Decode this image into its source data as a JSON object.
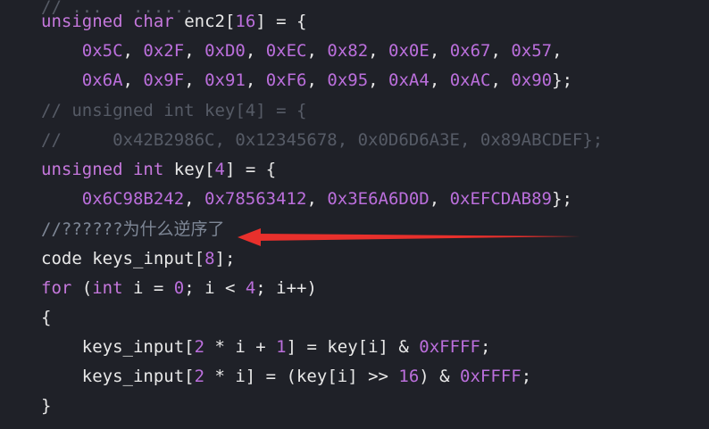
{
  "code_lines": [
    {
      "tokens": [
        {
          "t": "cm-faint",
          "v": "// ...   ......"
        }
      ]
    },
    {
      "tokens": [
        {
          "t": "kw",
          "v": "unsigned"
        },
        {
          "t": "pn",
          "v": " "
        },
        {
          "t": "kw",
          "v": "char"
        },
        {
          "t": "pn",
          "v": " "
        },
        {
          "t": "id",
          "v": "enc2"
        },
        {
          "t": "pn",
          "v": "["
        },
        {
          "t": "num",
          "v": "16"
        },
        {
          "t": "pn",
          "v": "] = {"
        }
      ]
    },
    {
      "tokens": [
        {
          "t": "pn",
          "v": "    "
        },
        {
          "t": "num",
          "v": "0x5C"
        },
        {
          "t": "pn",
          "v": ", "
        },
        {
          "t": "num",
          "v": "0x2F"
        },
        {
          "t": "pn",
          "v": ", "
        },
        {
          "t": "num",
          "v": "0xD0"
        },
        {
          "t": "pn",
          "v": ", "
        },
        {
          "t": "num",
          "v": "0xEC"
        },
        {
          "t": "pn",
          "v": ", "
        },
        {
          "t": "num",
          "v": "0x82"
        },
        {
          "t": "pn",
          "v": ", "
        },
        {
          "t": "num",
          "v": "0x0E"
        },
        {
          "t": "pn",
          "v": ", "
        },
        {
          "t": "num",
          "v": "0x67"
        },
        {
          "t": "pn",
          "v": ", "
        },
        {
          "t": "num",
          "v": "0x57"
        },
        {
          "t": "pn",
          "v": ","
        }
      ]
    },
    {
      "tokens": [
        {
          "t": "pn",
          "v": "    "
        },
        {
          "t": "num",
          "v": "0x6A"
        },
        {
          "t": "pn",
          "v": ", "
        },
        {
          "t": "num",
          "v": "0x9F"
        },
        {
          "t": "pn",
          "v": ", "
        },
        {
          "t": "num",
          "v": "0x91"
        },
        {
          "t": "pn",
          "v": ", "
        },
        {
          "t": "num",
          "v": "0xF6"
        },
        {
          "t": "pn",
          "v": ", "
        },
        {
          "t": "num",
          "v": "0x95"
        },
        {
          "t": "pn",
          "v": ", "
        },
        {
          "t": "num",
          "v": "0xA4"
        },
        {
          "t": "pn",
          "v": ", "
        },
        {
          "t": "num",
          "v": "0xAC"
        },
        {
          "t": "pn",
          "v": ", "
        },
        {
          "t": "num",
          "v": "0x90"
        },
        {
          "t": "pn",
          "v": "};"
        }
      ]
    },
    {
      "tokens": [
        {
          "t": "cm-faint",
          "v": "// unsigned int key[4] = {"
        }
      ]
    },
    {
      "tokens": [
        {
          "t": "cm-faint",
          "v": "//     0x42B2986C, 0x12345678, 0x0D6D6A3E, 0x89ABCDEF};"
        }
      ]
    },
    {
      "tokens": [
        {
          "t": "kw",
          "v": "unsigned"
        },
        {
          "t": "pn",
          "v": " "
        },
        {
          "t": "kw",
          "v": "int"
        },
        {
          "t": "pn",
          "v": " "
        },
        {
          "t": "id",
          "v": "key"
        },
        {
          "t": "pn",
          "v": "["
        },
        {
          "t": "num",
          "v": "4"
        },
        {
          "t": "pn",
          "v": "] = {"
        }
      ]
    },
    {
      "tokens": [
        {
          "t": "pn",
          "v": "    "
        },
        {
          "t": "num",
          "v": "0x6C98B242"
        },
        {
          "t": "pn",
          "v": ", "
        },
        {
          "t": "num",
          "v": "0x78563412"
        },
        {
          "t": "pn",
          "v": ", "
        },
        {
          "t": "num",
          "v": "0x3E6A6D0D"
        },
        {
          "t": "pn",
          "v": ", "
        },
        {
          "t": "num",
          "v": "0xEFCDAB89"
        },
        {
          "t": "pn",
          "v": "};"
        }
      ]
    },
    {
      "tokens": [
        {
          "t": "cm",
          "v": "//??????为什么逆序了"
        }
      ]
    },
    {
      "tokens": [
        {
          "t": "id",
          "v": "code"
        },
        {
          "t": "pn",
          "v": " "
        },
        {
          "t": "id",
          "v": "keys_input"
        },
        {
          "t": "pn",
          "v": "["
        },
        {
          "t": "num",
          "v": "8"
        },
        {
          "t": "pn",
          "v": "];"
        }
      ]
    },
    {
      "tokens": [
        {
          "t": "kw",
          "v": "for"
        },
        {
          "t": "pn",
          "v": " ("
        },
        {
          "t": "kw",
          "v": "int"
        },
        {
          "t": "pn",
          "v": " i = "
        },
        {
          "t": "num",
          "v": "0"
        },
        {
          "t": "pn",
          "v": "; i < "
        },
        {
          "t": "num",
          "v": "4"
        },
        {
          "t": "pn",
          "v": "; i++)"
        }
      ]
    },
    {
      "tokens": [
        {
          "t": "pn",
          "v": "{"
        }
      ]
    },
    {
      "tokens": [
        {
          "t": "pn",
          "v": "    keys_input["
        },
        {
          "t": "num",
          "v": "2"
        },
        {
          "t": "pn",
          "v": " * i + "
        },
        {
          "t": "num",
          "v": "1"
        },
        {
          "t": "pn",
          "v": "] = key[i] & "
        },
        {
          "t": "num",
          "v": "0xFFFF"
        },
        {
          "t": "pn",
          "v": ";"
        }
      ]
    },
    {
      "tokens": [
        {
          "t": "pn",
          "v": "    keys_input["
        },
        {
          "t": "num",
          "v": "2"
        },
        {
          "t": "pn",
          "v": " * i] = (key[i] >> "
        },
        {
          "t": "num",
          "v": "16"
        },
        {
          "t": "pn",
          "v": ") & "
        },
        {
          "t": "num",
          "v": "0xFFFF"
        },
        {
          "t": "pn",
          "v": ";"
        }
      ]
    },
    {
      "tokens": [
        {
          "t": "pn",
          "v": "}"
        }
      ]
    }
  ],
  "colors": {
    "background": "#1f2128",
    "keyword": "#c678dd",
    "number": "#bb6fdc",
    "comment": "#7e8796",
    "annotation_arrow": "#e8302c"
  },
  "icons": [
    "red-arrow-annotation-icon"
  ]
}
